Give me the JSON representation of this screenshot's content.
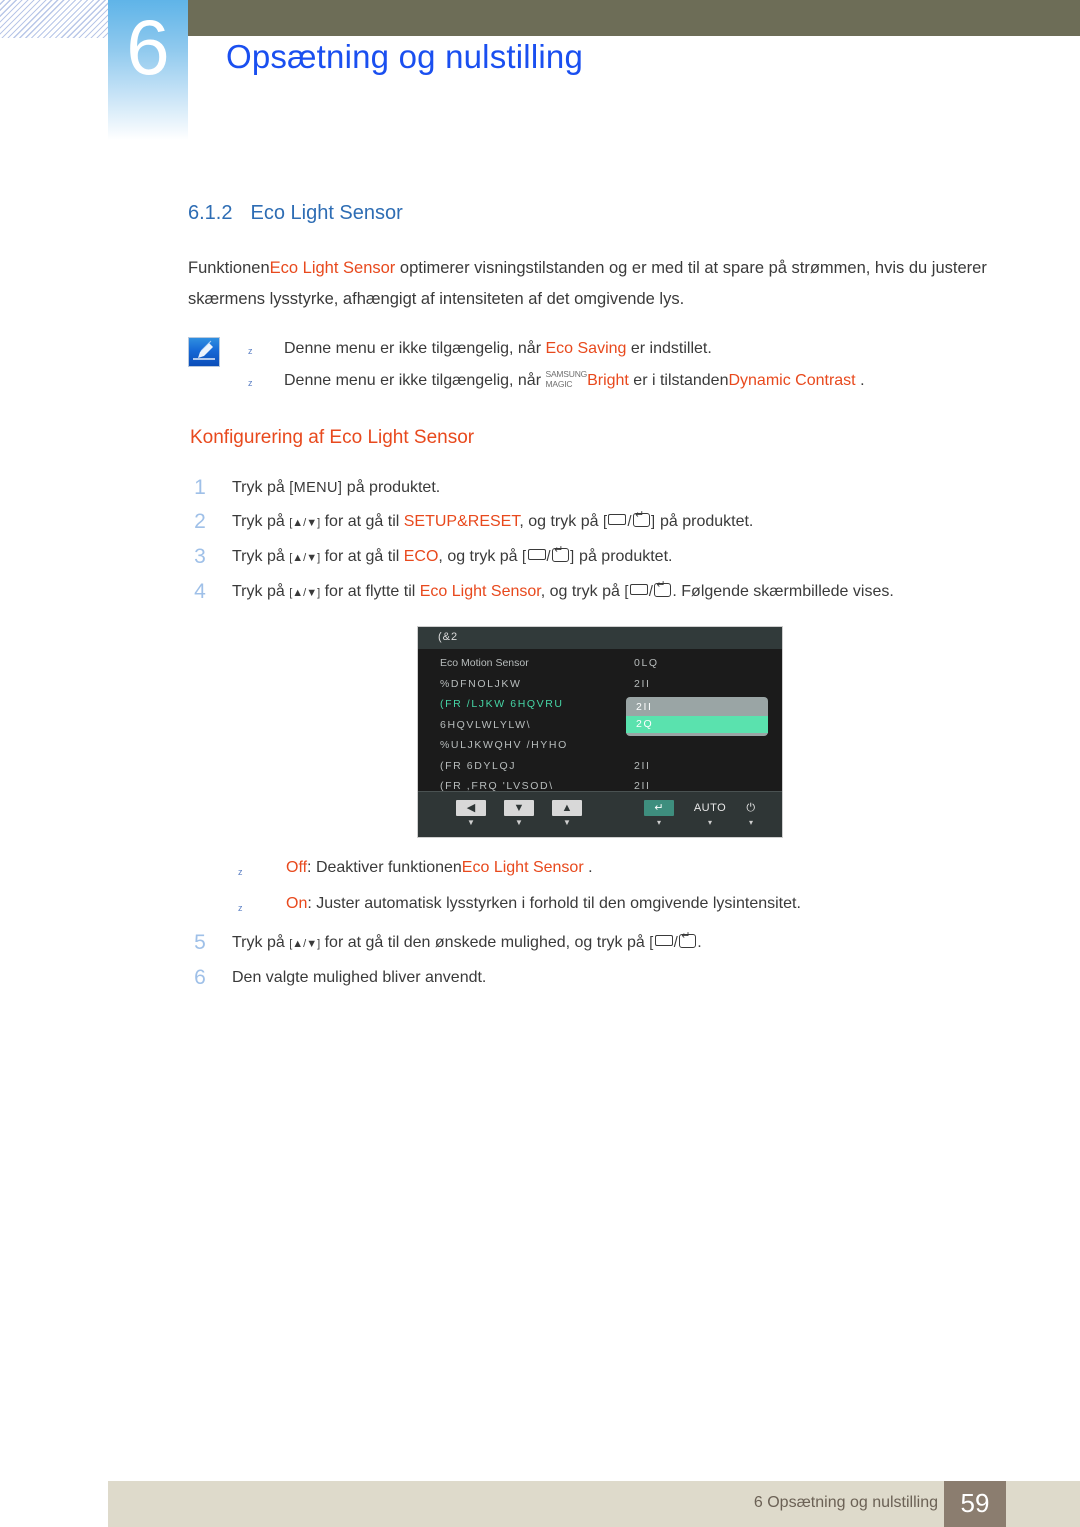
{
  "header": {
    "chapter_number": "6",
    "chapter_title": "Opsætning og nulstilling"
  },
  "section": {
    "number": "6.1.2",
    "title": "Eco Light Sensor"
  },
  "intro": {
    "part1": "Funktionen",
    "term": "Eco Light Sensor",
    "part2": " optimerer visningstilstanden og er med til at spare på strømmen, hvis du justerer skærmens lysstyrke, afhængigt af intensiteten af det omgivende lys."
  },
  "notes": {
    "bullet_mark": "z",
    "items": [
      {
        "pre": "Denne menu er ikke tilgængelig, når ",
        "term": "Eco Saving",
        "post": " er indstillet."
      },
      {
        "pre": "Denne menu er ikke tilgængelig, når ",
        "magic_top": "SAMSUNG",
        "magic_bottom": "MAGIC",
        "term": "Bright",
        "mid": " er i tilstanden",
        "term2": "Dynamic Contrast",
        "post": " ."
      }
    ]
  },
  "sub_heading": "Konfigurering af Eco Light Sensor",
  "steps": [
    {
      "num": "1",
      "pre": "Tryk på ",
      "key": "[MENU]",
      "post": " på produktet."
    },
    {
      "num": "2",
      "pre": "Tryk på ",
      "key": "[▲/▼]",
      "mid": " for at gå til ",
      "term": "SETUP&RESET",
      "mid2": ", og tryk på ",
      "key2_open": "[",
      "key2_sep": "/",
      "key2_close": "]",
      "post": " på produktet."
    },
    {
      "num": "3",
      "pre": "Tryk på ",
      "key": "[▲/▼]",
      "mid": " for at gå til ",
      "term": "ECO",
      "mid2": ", og tryk på ",
      "key2_open": "[",
      "key2_sep": "/",
      "key2_close": "]",
      "post": " på produktet."
    },
    {
      "num": "4",
      "pre": "Tryk på ",
      "key": "[▲/▼]",
      "mid": " for at flytte til ",
      "term": "Eco Light Sensor",
      "mid2": ", og tryk på ",
      "key2_open": "[",
      "key2_sep": "/",
      "key2_close": "",
      "post": ". Følgende skærmbillede vises."
    },
    {
      "num": "5",
      "pre": "Tryk på ",
      "key": "[▲/▼]",
      "mid": " for at gå til den ønskede mulighed, og tryk på ",
      "key2_open": "[",
      "key2_sep": "/",
      "key2_close": "",
      "post": "."
    },
    {
      "num": "6",
      "pre": "Den valgte mulighed bliver anvendt.",
      "key": "",
      "post": ""
    }
  ],
  "option_notes": {
    "bullet_mark": "z",
    "items": [
      {
        "label": "Off",
        "sep": ": ",
        "pre": "Deaktiver funktionen",
        "term": "Eco Light Sensor",
        "post": " ."
      },
      {
        "label": "On",
        "sep": ": ",
        "pre": "Juster automatisk lysstyrken i forhold til den omgivende lysintensitet.",
        "term": "",
        "post": ""
      }
    ]
  },
  "osd": {
    "title": "(&2",
    "rows": [
      {
        "label": "Eco Motion Sensor",
        "value": "0LQ",
        "active": false,
        "plain": true
      },
      {
        "label": "%DFNOLJKW",
        "value": "2II",
        "active": false,
        "plain": false
      },
      {
        "label": "(FR /LJKW 6HQVRU",
        "value": "",
        "active": true,
        "plain": false
      },
      {
        "label": "6HQVLWLYLW\\",
        "value": "",
        "active": false,
        "plain": false
      },
      {
        "label": "%ULJKWQHV /HYHO",
        "value": "",
        "active": false,
        "plain": false
      },
      {
        "label": "(FR 6DYLQJ",
        "value": "2II",
        "active": false,
        "plain": false
      },
      {
        "label": "(FR ,FRQ 'LVSOD\\",
        "value": "2II",
        "active": false,
        "plain": false
      }
    ],
    "dropdown": [
      {
        "label": "2II",
        "selected": false
      },
      {
        "label": "2Q",
        "selected": true
      }
    ],
    "buttons": [
      {
        "name": "left-arrow",
        "face": "◀",
        "style": "light",
        "tick": "▼"
      },
      {
        "name": "down-arrow",
        "face": "▼",
        "style": "light",
        "tick": "▼"
      },
      {
        "name": "up-arrow",
        "face": "▲",
        "style": "light",
        "tick": "▼"
      },
      {
        "name": "enter",
        "face": "↵",
        "style": "dark",
        "tick": "▾"
      },
      {
        "name": "auto",
        "face": "AUTO",
        "style": "plain",
        "tick": "▾"
      },
      {
        "name": "power",
        "face": "⏻",
        "style": "plain",
        "tick": "▾"
      }
    ]
  },
  "footer": {
    "text": "6 Opsætning og nulstilling",
    "page": "59"
  }
}
